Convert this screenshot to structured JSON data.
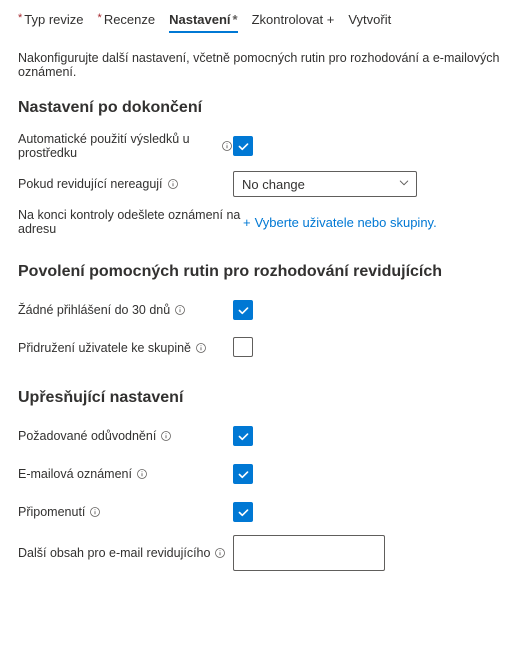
{
  "tabs": {
    "type": "Typ revize",
    "reviews": "Recenze",
    "settings": "Nastavení",
    "check": "Zkontrolovat +",
    "create": "Vytvořit"
  },
  "description": "Nakonfigurujte další nastavení, včetně pomocných rutin pro rozhodování a e-mailových oznámení.",
  "sections": {
    "completion": "Nastavení po dokončení",
    "helpers": "Povolení pomocných rutin pro rozhodování revidujících",
    "advanced": "Upřesňující nastavení"
  },
  "completion": {
    "autoApply": "Automatické použití výsledků u prostředku",
    "noResponse": "Pokud revidující nereagují",
    "noResponseValue": "No change",
    "notifyEnd": "Na konci kontroly odešlete oznámení na adresu",
    "peoplePicker": "Vyberte uživatele nebo skupiny."
  },
  "helpers": {
    "noSignin": "Žádné přihlášení do 30 dnů",
    "groupAffil": "Přidružení uživatele ke skupině"
  },
  "advanced": {
    "justification": "Požadované odůvodnění",
    "emailNotif": "E-mailová oznámení",
    "reminders": "Připomenutí",
    "additionalEmail": "Další obsah pro e-mail revidujícího"
  }
}
